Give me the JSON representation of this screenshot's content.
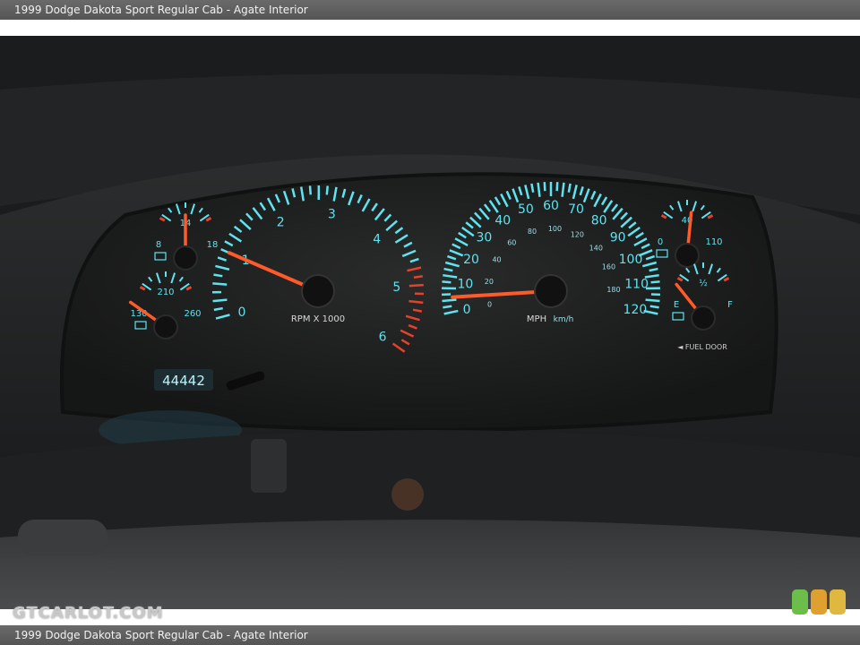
{
  "caption": "1999 Dodge Dakota Sport Regular Cab - Agate Interior",
  "watermark": "GTCARLOT.COM",
  "odometer": "44442",
  "tach": {
    "labels": [
      "0",
      "1",
      "2",
      "3",
      "4",
      "5",
      "6"
    ],
    "unit": "RPM X 1000",
    "needle_value": 1.0
  },
  "speedo": {
    "mph_labels": [
      "0",
      "10",
      "20",
      "30",
      "40",
      "50",
      "60",
      "70",
      "80",
      "90",
      "100",
      "110",
      "120"
    ],
    "kmh_labels": [
      "0",
      "20",
      "40",
      "60",
      "80",
      "100",
      "120",
      "140",
      "160",
      "180"
    ],
    "unit_mph": "MPH",
    "unit_kmh": "km/h",
    "needle_value_mph": 5
  },
  "voltage": {
    "labels": [
      "8",
      "14",
      "18"
    ],
    "needle": "14"
  },
  "temp": {
    "labels": [
      "130",
      "210",
      "260"
    ],
    "needle": "130"
  },
  "oil": {
    "labels": [
      "0",
      "40",
      "110"
    ],
    "needle": "40"
  },
  "fuel": {
    "labels": [
      "E",
      "½",
      "F"
    ],
    "needle": "E",
    "door_label": "◄ FUEL DOOR"
  },
  "colors": {
    "glow": "#5fe3f0",
    "needle": "#ff5a2a",
    "redline": "#e8412a",
    "panel": "#1e1f1f"
  },
  "icons": [
    "battery-icon",
    "coolant-icon",
    "oil-can-icon",
    "fuel-pump-icon"
  ],
  "badges": [
    "#6dbd4a",
    "#e0a030",
    "#e0b840"
  ]
}
